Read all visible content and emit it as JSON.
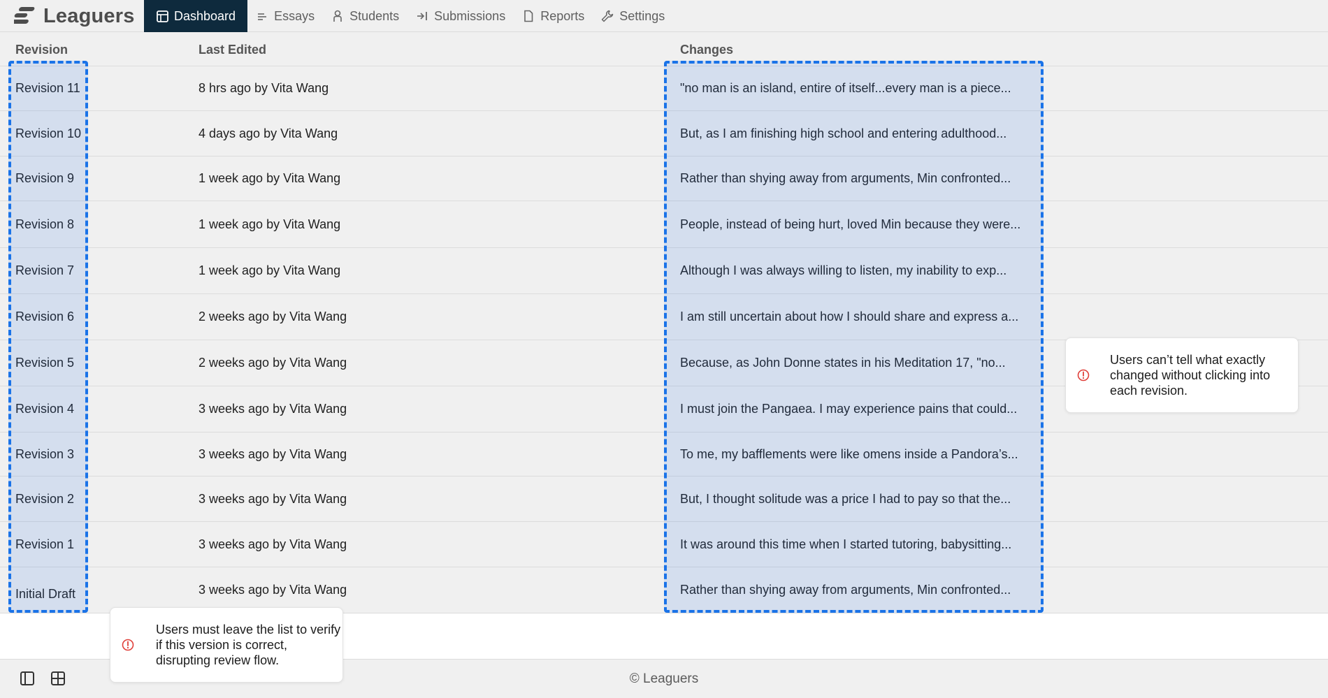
{
  "app": {
    "brand_name": "Leaguers"
  },
  "nav": [
    {
      "label": "Dashboard",
      "icon": "layout-icon",
      "active": true
    },
    {
      "label": "Essays",
      "icon": "lines-icon",
      "active": false
    },
    {
      "label": "Students",
      "icon": "person-icon",
      "active": false
    },
    {
      "label": "Submissions",
      "icon": "arrow-in-icon",
      "active": false
    },
    {
      "label": "Reports",
      "icon": "document-icon",
      "active": false
    },
    {
      "label": "Settings",
      "icon": "wrench-icon",
      "active": false
    }
  ],
  "table": {
    "headers": {
      "revision": "Revision",
      "last_edited": "Last Edited",
      "changes": "Changes"
    },
    "rows": [
      {
        "revision": "Revision 11",
        "last_edited": "8 hrs ago by Vita Wang",
        "changes": "\"no man is an island, entire of itself...every man is a piece..."
      },
      {
        "revision": "Revision 10",
        "last_edited": "4 days ago by Vita Wang",
        "changes": "But, as I am finishing high school and entering adulthood..."
      },
      {
        "revision": "Revision 9",
        "last_edited": "1 week ago by Vita Wang",
        "changes": "Rather than shying away from arguments, Min confronted..."
      },
      {
        "revision": "Revision 8",
        "last_edited": "1 week ago by Vita Wang",
        "changes": "People, instead of being hurt, loved Min because they were..."
      },
      {
        "revision": "Revision 7",
        "last_edited": "1 week ago by Vita Wang",
        "changes": "Although I was always willing to listen, my inability to exp..."
      },
      {
        "revision": "Revision 6",
        "last_edited": "2 weeks ago by Vita Wang",
        "changes": "I am still uncertain about how I should share and express a..."
      },
      {
        "revision": "Revision 5",
        "last_edited": "2 weeks ago by Vita Wang",
        "changes": "Because, as John Donne states in his Meditation 17, \"no..."
      },
      {
        "revision": "Revision 4",
        "last_edited": "3 weeks ago by Vita Wang",
        "changes": "I must join the Pangaea. I may experience pains that could..."
      },
      {
        "revision": "Revision 3",
        "last_edited": "3 weeks ago by Vita Wang",
        "changes": "To me, my bafflements were like omens inside a Pandora’s..."
      },
      {
        "revision": "Revision 2",
        "last_edited": "3 weeks ago by Vita Wang",
        "changes": "But, I thought solitude was a price I had to pay so that the..."
      },
      {
        "revision": "Revision 1",
        "last_edited": "3 weeks ago by Vita Wang",
        "changes": "It was around this time when I started tutoring, babysitting..."
      },
      {
        "revision": "Initial Draft",
        "last_edited": "3 weeks ago by Vita Wang",
        "changes": "Rather than shying away from arguments, Min confronted..."
      }
    ]
  },
  "annotations": {
    "changes_column": "Users can’t tell what exactly changed without clicking into each revision.",
    "revision_column": "Users must leave the list to verify if this version is correct, disrupting review flow."
  },
  "footer": {
    "text": "© Leaguers"
  },
  "colors": {
    "nav_active_bg": "#0e2a3d",
    "highlight_border": "#1a73e8",
    "warning": "#e0403a",
    "page_bg": "#f0f0f0"
  }
}
